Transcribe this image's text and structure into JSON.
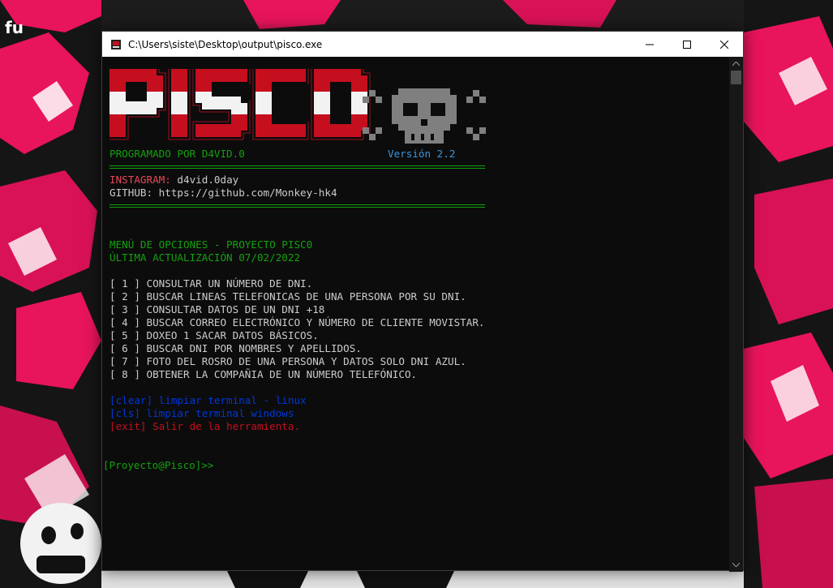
{
  "desktop": {
    "label": "fu"
  },
  "window": {
    "title": "C:\\Users\\siste\\Desktop\\output\\pisco.exe",
    "buttons": {
      "minimize": "minimize-icon",
      "maximize": "maximize-icon",
      "close": "close-icon"
    }
  },
  "banner": {
    "logo_text": "PISCO",
    "programmer": "PROGRAMADO POR D4VID.0",
    "version": "Versión 2.2"
  },
  "social": {
    "instagram_label": "INSTAGRAM:",
    "instagram_value": "d4vid.0day",
    "github": "GITHUB: https://github.com/Monkey-hk4"
  },
  "menu": {
    "header": "MENÚ DE OPCIONES - PROYECTO PISC0",
    "updated": "ÚLTIMA ACTUALIZACIÓN 07/02/2022",
    "options": [
      "[ 1 ] CONSULTAR UN NÚMERO DE DNI.",
      "[ 2 ] BUSCAR LINEAS TELEFONICAS DE UNA PERSONA POR SU DNI.",
      "[ 3 ] CONSULTAR DATOS DE UN DNI +18",
      "[ 4 ] BUSCAR CORREO ELECTRÓNICO Y NÚMERO DE CLIENTE MOVISTAR.",
      "[ 5 ] DOXEO 1 SACAR DATOS BÁSICOS.",
      "[ 6 ] BUSCAR DNI POR NOMBRES Y APELLIDOS.",
      "[ 7 ] FOTO DEL ROSRO DE UNA PERSONA Y DATOS SOLO DNI AZUL.",
      "[ 8 ] OBTENER LA COMPAÑIA DE UN NÚMERO TELEFÓNICO."
    ],
    "commands": [
      "[clear] limpiar terminal - linux",
      "[cls] limpiar terminal windows",
      "[exit] Salir de la herramienta."
    ]
  },
  "prompt": "[Proyecto@Pisco]>>",
  "colors": {
    "green": "#13a10e",
    "blue": "#3a96dd",
    "dark_blue": "#0037da",
    "red": "#c50f1f",
    "light_red": "#e74856",
    "console_bg": "#0c0c0c",
    "wallpaper_pink": "#e8145c"
  }
}
